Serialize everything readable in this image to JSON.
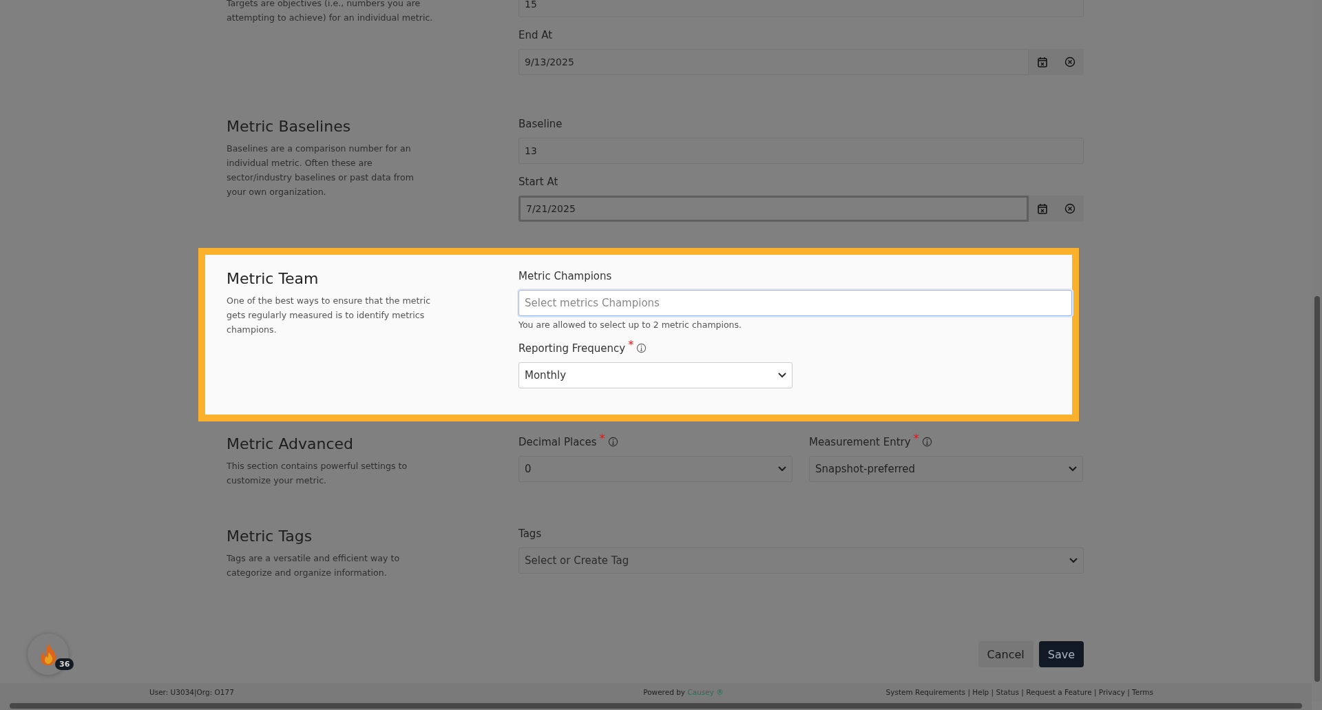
{
  "sections": [
    {
      "description": "Targets are objectives (i.e., numbers you are attempting to achieve) for an individual metric.",
      "highlighted": false,
      "rows": [
        {
          "fields": [
            {
              "kind": "text",
              "value": "15"
            }
          ]
        },
        {
          "fields": [
            {
              "kind": "date",
              "label": "End At",
              "value": "9/13/2025",
              "focused": false
            }
          ]
        }
      ]
    },
    {
      "title": "Metric Baselines",
      "description": "Baselines are a comparison number for an individual metric. Often these are sector/industry baselines or past data from your own organization.",
      "highlighted": false,
      "rows": [
        {
          "fields": [
            {
              "kind": "text",
              "label": "Baseline",
              "value": "13"
            }
          ]
        },
        {
          "fields": [
            {
              "kind": "date",
              "label": "Start At",
              "value": "7/21/2025",
              "focused": true
            }
          ]
        }
      ]
    },
    {
      "title": "Metric Team",
      "description": "One of the best ways to ensure that the metric gets regularly measured is to identify metrics champions.",
      "highlighted": true,
      "rows": [
        {
          "fields": [
            {
              "kind": "multiselect",
              "label": "Metric Champions",
              "placeholder": "Select metrics Champions",
              "help": "You are allowed to select up to 2 metric champions."
            }
          ]
        },
        {
          "fields": [
            {
              "kind": "select",
              "label": "Reporting Frequency",
              "required_mark": "*",
              "info": true,
              "value": "Monthly",
              "half": true
            }
          ]
        }
      ]
    },
    {
      "title": "Metric Advanced",
      "description": "This section contains powerful settings to customize your metric.",
      "highlighted": false,
      "rows": [
        {
          "fields": [
            {
              "kind": "select",
              "label": "Decimal Places",
              "required_mark": "*",
              "info": true,
              "value": "0",
              "half": true
            },
            {
              "kind": "select",
              "label": "Measurement Entry",
              "required_mark": "*",
              "info": true,
              "value": "Snapshot-preferred",
              "half": true
            }
          ]
        }
      ]
    },
    {
      "title": "Metric Tags",
      "description": "Tags are a versatile and efficient way to categorize and organize information.",
      "highlighted": false,
      "rows": [
        {
          "fields": [
            {
              "kind": "select",
              "label": "Tags",
              "placeholder": "Select or Create Tag"
            }
          ]
        }
      ]
    }
  ],
  "buttons": [
    {
      "label": "Cancel",
      "kind": "secondary"
    },
    {
      "label": "Save",
      "kind": "primary"
    }
  ],
  "notification": {
    "count": "36"
  },
  "footer": {
    "user": "User: U3034|Org: O177",
    "powered_by": "Powered by",
    "brand": "Causey",
    "brand_mark": "®",
    "links": [
      "System Requirements",
      "Help",
      "Status",
      "Request a Feature",
      "Privacy",
      "Terms"
    ],
    "separator": "|"
  }
}
